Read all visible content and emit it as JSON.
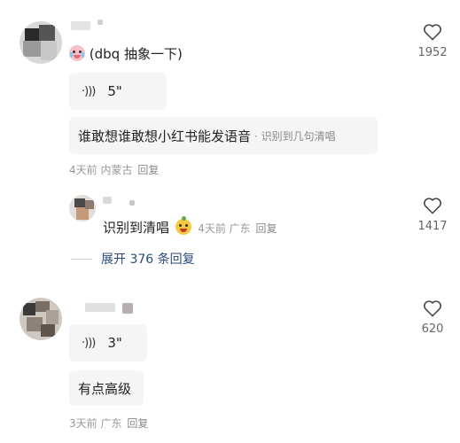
{
  "colors": {
    "link": "#2c4a7c",
    "meta": "#9a9a9a",
    "chip_bg": "#f5f5f5"
  },
  "comments": [
    {
      "text": "(dbq 抽象一下)",
      "emoji": "crying-face-emoji",
      "voice_duration": "5\"",
      "reply_bubble": {
        "text": "谁敢想谁敢想小红书能发语音",
        "aux": "· 识别到几句清唱"
      },
      "time": "4天前",
      "location": "内蒙古",
      "reply_label": "回复",
      "likes": "1952"
    },
    {
      "text": "识别到清唱",
      "emoji": "smiling-fruit-emoji",
      "time": "4天前",
      "location": "广东",
      "reply_label": "回复",
      "likes": "1417",
      "expand_label": "展开 376 条回复"
    },
    {
      "voice_duration": "3\"",
      "bubble_text": "有点高级",
      "time": "3天前",
      "location": "广东",
      "reply_label": "回复",
      "likes": "620"
    }
  ],
  "icons": {
    "voice": "voice-wave-icon",
    "like": "heart-outline-icon"
  }
}
